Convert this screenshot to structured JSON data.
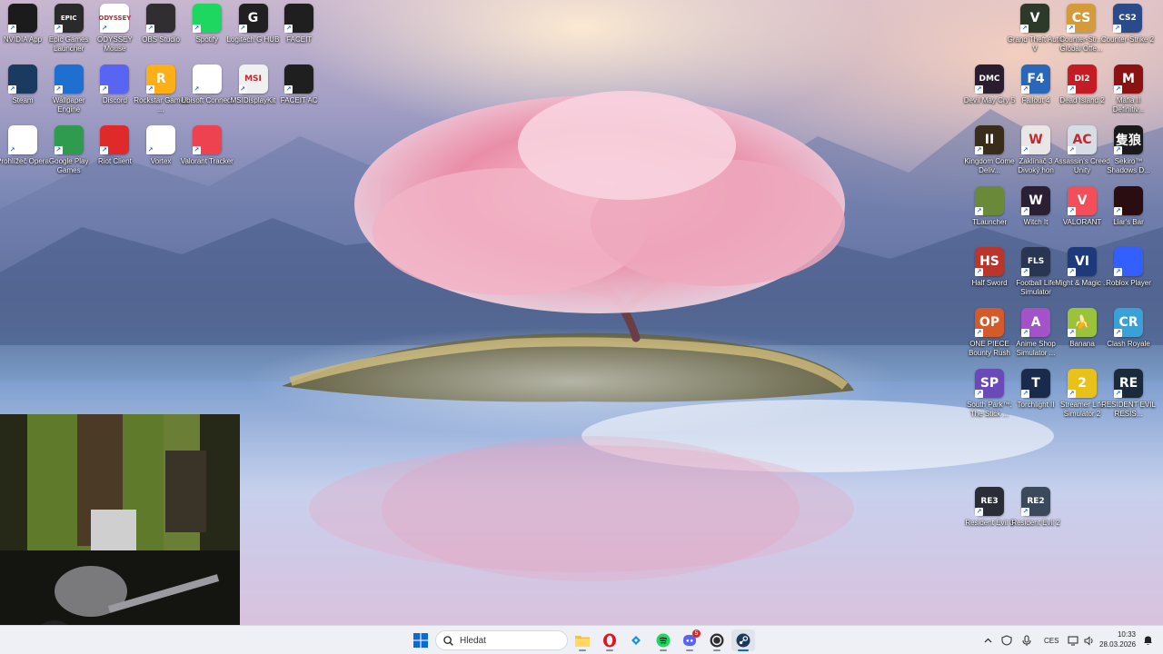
{
  "desktop": {
    "left_icons": [
      {
        "label": "NVIDIA App",
        "icon": "nvidia-icon",
        "glyph": "",
        "bg": "#1b1b1b"
      },
      {
        "label": "Epic Games Launcher",
        "icon": "epic-games-icon",
        "glyph": "EPIC",
        "bg": "#2a2a2a"
      },
      {
        "label": "ODYSSEY Mouse",
        "icon": "odyssey-mouse-icon",
        "glyph": "ODYSSEY",
        "bg": "#ffffff"
      },
      {
        "label": "OBS Studio",
        "icon": "obs-icon",
        "glyph": "",
        "bg": "#302e31"
      },
      {
        "label": "Spotify",
        "icon": "spotify-icon",
        "glyph": "",
        "bg": "#1ed760"
      },
      {
        "label": "Logitech G HUB",
        "icon": "logitech-g-icon",
        "glyph": "G",
        "bg": "#202020"
      },
      {
        "label": "FACEIT",
        "icon": "faceit-icon",
        "glyph": "",
        "bg": "#1f1f1f"
      },
      {
        "label": "Steam",
        "icon": "steam-icon",
        "glyph": "",
        "bg": "#1b3a5f"
      },
      {
        "label": "Wallpaper Engine",
        "icon": "wallpaper-engine-icon",
        "glyph": "",
        "bg": "#1f6fd1"
      },
      {
        "label": "Discord",
        "icon": "discord-icon",
        "glyph": "",
        "bg": "#5865f2"
      },
      {
        "label": "Rockstar Games ...",
        "icon": "rockstar-icon",
        "glyph": "R",
        "bg": "#fcaf17"
      },
      {
        "label": "Ubisoft Connect",
        "icon": "ubisoft-icon",
        "glyph": "",
        "bg": "#ffffff"
      },
      {
        "label": "MSIDisplayKit",
        "icon": "msi-displaykit-icon",
        "glyph": "MSI",
        "bg": "#f0f0f0"
      },
      {
        "label": "FACEIT AC",
        "icon": "faceit-ac-icon",
        "glyph": "",
        "bg": "#1f1f1f"
      },
      {
        "label": "Prohlížeč Opera",
        "icon": "opera-icon",
        "glyph": "",
        "bg": "#ffffff"
      },
      {
        "label": "Google Play Games",
        "icon": "google-play-games-icon",
        "glyph": "",
        "bg": "#2e9b4f"
      },
      {
        "label": "Riot Client",
        "icon": "riot-client-icon",
        "glyph": "",
        "bg": "#e02a2a"
      },
      {
        "label": "Vortex",
        "icon": "vortex-icon",
        "glyph": "",
        "bg": "#ffffff"
      },
      {
        "label": "Valorant Tracker",
        "icon": "valorant-tracker-icon",
        "glyph": "",
        "bg": "#ef4250"
      }
    ],
    "right_icons": [
      {
        "label": "Grand Theft Auto V",
        "icon": "gta-v-icon",
        "glyph": "V",
        "bg": "#2d3a2a"
      },
      {
        "label": "Counter-Str... Global Offe...",
        "icon": "csgo-icon",
        "glyph": "CS",
        "bg": "#d39b3a"
      },
      {
        "label": "Counter-Strike 2",
        "icon": "cs2-icon",
        "glyph": "CS2",
        "bg": "#2a4a8a"
      },
      {
        "label": "Devil May Cry 5",
        "icon": "devil-may-cry-icon",
        "glyph": "DMC",
        "bg": "#2a1e2e"
      },
      {
        "label": "Fallout 4",
        "icon": "fallout-4-icon",
        "glyph": "F4",
        "bg": "#2a67b8"
      },
      {
        "label": "Dead Island 2",
        "icon": "dead-island-2-icon",
        "glyph": "DI2",
        "bg": "#c31c25"
      },
      {
        "label": "Mafia II Definitiv...",
        "icon": "mafia-ii-icon",
        "glyph": "M",
        "bg": "#8b1212"
      },
      {
        "label": "Kingdom Come Deliv...",
        "icon": "kingdom-come-icon",
        "glyph": "II",
        "bg": "#3a2c1a"
      },
      {
        "label": "Zaklínač 3 Divoký hon",
        "icon": "witcher-3-icon",
        "glyph": "W",
        "bg": "#e9e6e6"
      },
      {
        "label": "Assassin's Creed Unity",
        "icon": "assassins-creed-icon",
        "glyph": "AC",
        "bg": "#d7dde5"
      },
      {
        "label": "Sekiro™ Shadows D...",
        "icon": "sekiro-icon",
        "glyph": "隻狼",
        "bg": "#1a1a1a"
      },
      {
        "label": "TLauncher",
        "icon": "tlauncher-icon",
        "glyph": "",
        "bg": "#6a8a3a"
      },
      {
        "label": "Witch It",
        "icon": "witch-it-icon",
        "glyph": "W",
        "bg": "#2a1f33"
      },
      {
        "label": "VALORANT",
        "icon": "valorant-icon",
        "glyph": "V",
        "bg": "#f34f5a"
      },
      {
        "label": "Liar's Bar",
        "icon": "liars-bar-icon",
        "glyph": "",
        "bg": "#2a0d10"
      },
      {
        "label": "Half Sword",
        "icon": "half-sword-icon",
        "glyph": "HS",
        "bg": "#b8362c"
      },
      {
        "label": "Football Life Simulator",
        "icon": "football-life-icon",
        "glyph": "FLS",
        "bg": "#2a3552"
      },
      {
        "label": "Might & Magic ...",
        "icon": "might-and-magic-icon",
        "glyph": "VI",
        "bg": "#1e3a7a"
      },
      {
        "label": "Roblox Player",
        "icon": "roblox-icon",
        "glyph": "",
        "bg": "#335fff"
      },
      {
        "label": "ONE PIECE Bounty Rush",
        "icon": "one-piece-icon",
        "glyph": "OP",
        "bg": "#d45a2a"
      },
      {
        "label": "Anime Shop Simulator ...",
        "icon": "anime-shop-icon",
        "glyph": "A",
        "bg": "#a352c8"
      },
      {
        "label": "Banana",
        "icon": "banana-icon",
        "glyph": "🍌",
        "bg": "#9ac23a"
      },
      {
        "label": "Clash Royale",
        "icon": "clash-royale-icon",
        "glyph": "CR",
        "bg": "#3aa0d8"
      },
      {
        "label": "South Park™: The Stick ...",
        "icon": "south-park-icon",
        "glyph": "SP",
        "bg": "#6a4ab8"
      },
      {
        "label": "Torchlight II",
        "icon": "torchlight-icon",
        "glyph": "T",
        "bg": "#1a2a4a"
      },
      {
        "label": "Streamer Life Simulator 2",
        "icon": "streamer-life-icon",
        "glyph": "2",
        "bg": "#e8c21a"
      },
      {
        "label": "RESIDENT EVIL RESIS...",
        "icon": "re-resistance-icon",
        "glyph": "RE",
        "bg": "#1a2a3a"
      },
      {
        "label": "Resident Evil 3",
        "icon": "resident-evil-3-icon",
        "glyph": "RE3",
        "bg": "#2a2d36"
      },
      {
        "label": "Resident Evil 2",
        "icon": "resident-evil-2-icon",
        "glyph": "RE2",
        "bg": "#3a4a5a"
      }
    ]
  },
  "taskbar": {
    "search_placeholder": "Hledat",
    "apps": [
      {
        "icon": "file-explorer-icon",
        "running": true,
        "active": false
      },
      {
        "icon": "opera-icon",
        "running": true,
        "active": false
      },
      {
        "icon": "copilot-icon",
        "running": false,
        "active": false
      },
      {
        "icon": "spotify-icon",
        "running": true,
        "active": false
      },
      {
        "icon": "discord-icon",
        "running": true,
        "active": false,
        "badge": "5"
      },
      {
        "icon": "obs-icon",
        "running": true,
        "active": false
      },
      {
        "icon": "steam-icon",
        "running": true,
        "active": true
      }
    ],
    "tray": {
      "language": "CES",
      "time": "10:33",
      "date": "28.03.2026"
    }
  },
  "colors": {
    "taskbar_bg": "#eef0f5",
    "accent": "#0b6bd3"
  }
}
